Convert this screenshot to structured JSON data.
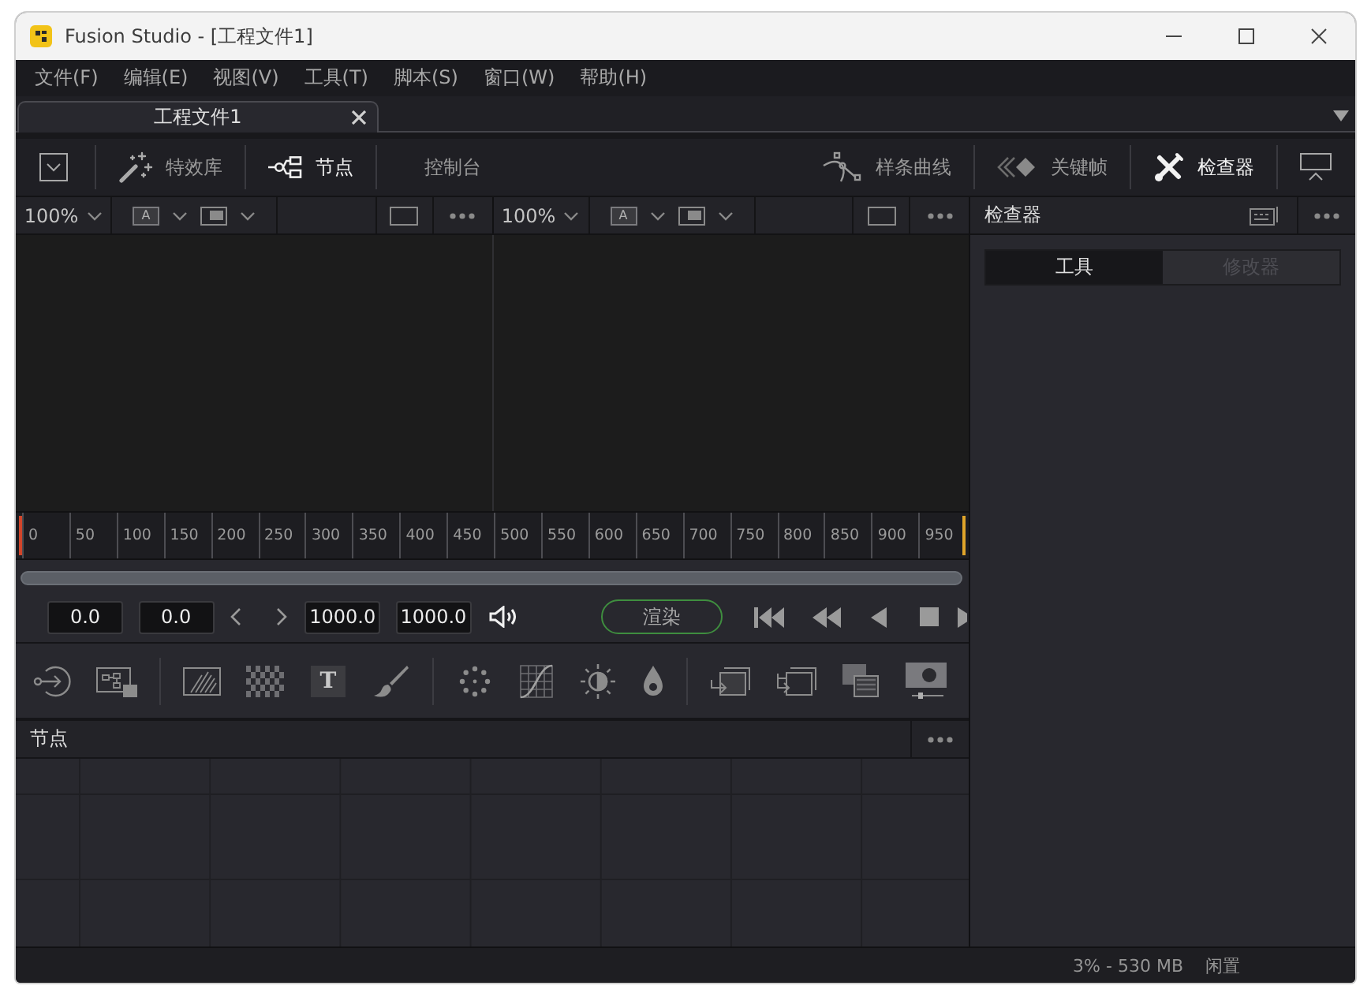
{
  "window": {
    "title": "Fusion Studio - [工程文件1]"
  },
  "menu": [
    "文件(F)",
    "编辑(E)",
    "视图(V)",
    "工具(T)",
    "脚本(S)",
    "窗口(W)",
    "帮助(H)"
  ],
  "document_tabs": [
    {
      "label": "工程文件1",
      "selected": true
    }
  ],
  "toolbar": {
    "left": [
      {
        "kind": "effects",
        "label": "特效库",
        "selected": false
      },
      {
        "kind": "nodes",
        "label": "节点",
        "selected": true
      },
      {
        "kind": "console",
        "label": "控制台",
        "selected": false
      }
    ],
    "right": [
      {
        "kind": "spline",
        "label": "样条曲线",
        "selected": false
      },
      {
        "kind": "keyframes",
        "label": "关键帧",
        "selected": false
      },
      {
        "kind": "inspector",
        "label": "检查器",
        "selected": true
      }
    ]
  },
  "viewers": [
    {
      "zoom": "100%",
      "channel": "A"
    },
    {
      "zoom": "100%",
      "channel": "A"
    }
  ],
  "timeline": {
    "ticks": [
      "0",
      "50",
      "100",
      "150",
      "200",
      "250",
      "300",
      "350",
      "400",
      "450",
      "500",
      "550",
      "600",
      "650",
      "700",
      "750",
      "800",
      "850",
      "900",
      "950"
    ]
  },
  "transport": {
    "start_fields": [
      "0.0",
      "0.0"
    ],
    "end_fields": [
      "1000.0",
      "1000.0"
    ],
    "render_button": "渲染"
  },
  "tools": {
    "text_tool": "T"
  },
  "node_panel": {
    "title": "节点"
  },
  "inspector": {
    "title": "检查器",
    "tabs": [
      {
        "label": "工具",
        "selected": true,
        "disabled": false
      },
      {
        "label": "修改器",
        "selected": false,
        "disabled": true
      }
    ]
  },
  "status_bar": {
    "usage": "3% - 530 MB",
    "state": "闲置"
  }
}
